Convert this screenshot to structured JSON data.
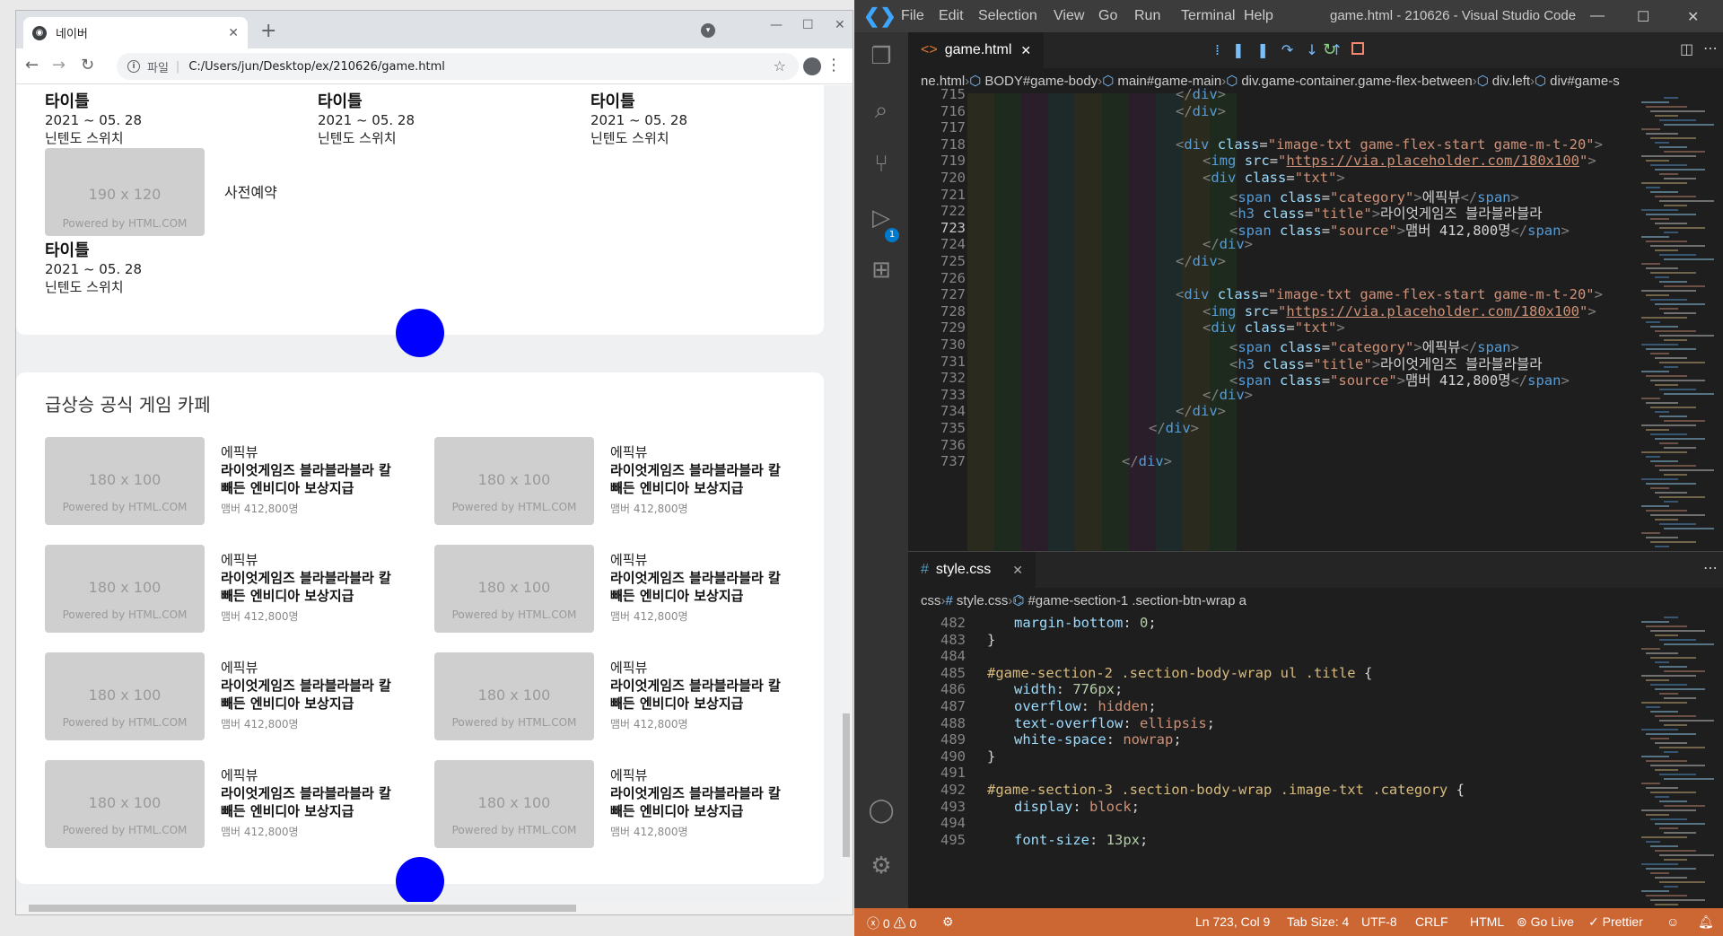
{
  "chrome": {
    "tab_title": "네이버",
    "address": "C:/Users/jun/Desktop/ex/210626/game.html",
    "file_label": "파일",
    "icons": [
      "globe-icon",
      "close-icon",
      "plus-icon",
      "back-icon",
      "forward-icon",
      "reload-icon",
      "info-icon",
      "star-icon",
      "profile-icon",
      "menu-icon"
    ]
  },
  "page": {
    "top_games": [
      {
        "title": "타이틀",
        "date": "2021 ~ 05. 28",
        "source": "닌텐도 스위치"
      },
      {
        "title": "타이틀",
        "date": "2021 ~ 05. 28",
        "source": "닌텐도 스위치"
      },
      {
        "title": "타이틀",
        "date": "2021 ~ 05. 28",
        "source": "닌텐도 스위치"
      }
    ],
    "preorder_ph": {
      "size": "190 x 120",
      "powered": "Powered by HTML.COM"
    },
    "preorder_label": "사전예약",
    "bottom_game": {
      "title": "타이틀",
      "date": "2021 ~ 05. 28",
      "source": "닌텐도 스위치"
    },
    "section_title": "급상승 공식 게임 카페",
    "cafe_ph": {
      "size": "180 x 100",
      "powered": "Powered by HTML.COM"
    },
    "cafe_items": [
      {
        "category": "에픽뷰",
        "title1": "라이엇게임즈 블라블라블라 칼",
        "title2": "빼든 엔비디아 보상지급",
        "source": "맴버 412,800명"
      },
      {
        "category": "에픽뷰",
        "title1": "라이엇게임즈 블라블라블라 칼",
        "title2": "빼든 엔비디아 보상지급",
        "source": "맴버 412,800명"
      },
      {
        "category": "에픽뷰",
        "title1": "라이엇게임즈 블라블라블라 칼",
        "title2": "빼든 엔비디아 보상지급",
        "source": "맴버 412,800명"
      },
      {
        "category": "에픽뷰",
        "title1": "라이엇게임즈 블라블라블라 칼",
        "title2": "빼든 엔비디아 보상지급",
        "source": "맴버 412,800명"
      },
      {
        "category": "에픽뷰",
        "title1": "라이엇게임즈 블라블라블라 칼",
        "title2": "빼든 엔비디아 보상지급",
        "source": "맴버 412,800명"
      },
      {
        "category": "에픽뷰",
        "title1": "라이엇게임즈 블라블라블라 칼",
        "title2": "빼든 엔비디아 보상지급",
        "source": "맴버 412,800명"
      },
      {
        "category": "에픽뷰",
        "title1": "라이엇게임즈 블라블라블라 칼",
        "title2": "빼든 엔비디아 보상지급",
        "source": "맴버 412,800명"
      },
      {
        "category": "에픽뷰",
        "title1": "라이엇게임즈 블라블라블라 칼",
        "title2": "빼든 엔비디아 보상지급",
        "source": "맴버 412,800명"
      }
    ],
    "colors": {
      "dot": "#0000ff",
      "placeholder": "#cfcfcf"
    }
  },
  "vscode": {
    "menu": [
      "File",
      "Edit",
      "Selection",
      "View",
      "Go",
      "Run",
      "Terminal",
      "Help"
    ],
    "window_title": "game.html - 210626 - Visual Studio Code",
    "tab1": "game.html",
    "tab2": "style.css",
    "breadcrumb1": [
      "ne.html",
      "BODY#game-body",
      "main#game-main",
      "div.game-container.game-flex-between",
      "div.left",
      "div#game-s"
    ],
    "breadcrumb2": [
      "css",
      "style.css",
      "#game-section-1 .section-btn-wrap a"
    ],
    "debug_badge": "1",
    "html_lines": [
      {
        "n": "715",
        "c": "</div>"
      },
      {
        "n": "716",
        "c": "</div>"
      },
      {
        "n": "717",
        "c": ""
      },
      {
        "n": "718",
        "c": "<div class=\"image-txt game-flex-start game-m-t-20\">"
      },
      {
        "n": "719",
        "c": "<img src=\"https://via.placeholder.com/180x100\">"
      },
      {
        "n": "720",
        "c": "<div class=\"txt\">"
      },
      {
        "n": "721",
        "c": "<span class=\"category\">에픽뷰</span>"
      },
      {
        "n": "722",
        "c": "<h3 class=\"title\">라이엇게임즈 블라블라블라"
      },
      {
        "n": "723",
        "c": "<span class=\"source\">맴버 412,800명</span>"
      },
      {
        "n": "724",
        "c": "</div>"
      },
      {
        "n": "725",
        "c": "</div>"
      },
      {
        "n": "726",
        "c": ""
      },
      {
        "n": "727",
        "c": "<div class=\"image-txt game-flex-start game-m-t-20\">"
      },
      {
        "n": "728",
        "c": "<img src=\"https://via.placeholder.com/180x100\">"
      },
      {
        "n": "729",
        "c": "<div class=\"txt\">"
      },
      {
        "n": "730",
        "c": "<span class=\"category\">에픽뷰</span>"
      },
      {
        "n": "731",
        "c": "<h3 class=\"title\">라이엇게임즈 블라블라블라"
      },
      {
        "n": "732",
        "c": "<span class=\"source\">맴버 412,800명</span>"
      },
      {
        "n": "733",
        "c": "</div>"
      },
      {
        "n": "734",
        "c": "</div>"
      },
      {
        "n": "735",
        "c": "</div>"
      },
      {
        "n": "736",
        "c": ""
      },
      {
        "n": "737",
        "c": "</div>"
      }
    ],
    "css_lines": [
      {
        "n": "482",
        "c": "margin-bottom: 0;"
      },
      {
        "n": "483",
        "c": "}"
      },
      {
        "n": "484",
        "c": ""
      },
      {
        "n": "485",
        "c": "#game-section-2 .section-body-wrap ul .title {"
      },
      {
        "n": "486",
        "c": "width: 776px;"
      },
      {
        "n": "487",
        "c": "overflow: hidden;"
      },
      {
        "n": "488",
        "c": "text-overflow: ellipsis;"
      },
      {
        "n": "489",
        "c": "white-space: nowrap;"
      },
      {
        "n": "490",
        "c": "}"
      },
      {
        "n": "491",
        "c": ""
      },
      {
        "n": "492",
        "c": "#game-section-3 .section-body-wrap .image-txt .category {"
      },
      {
        "n": "493",
        "c": "display: block;"
      },
      {
        "n": "494",
        "c": ""
      },
      {
        "n": "495",
        "c": "font-size: 13px;"
      }
    ],
    "status": {
      "errors": "0",
      "warnings": "0",
      "position": "Ln 723, Col 9",
      "tab_size": "Tab Size: 4",
      "encoding": "UTF-8",
      "eol": "CRLF",
      "language": "HTML",
      "golive": "Go Live",
      "prettier": "Prettier"
    },
    "colors": {
      "status_bar": "#cc6633",
      "bg": "#1e1e1e"
    }
  }
}
